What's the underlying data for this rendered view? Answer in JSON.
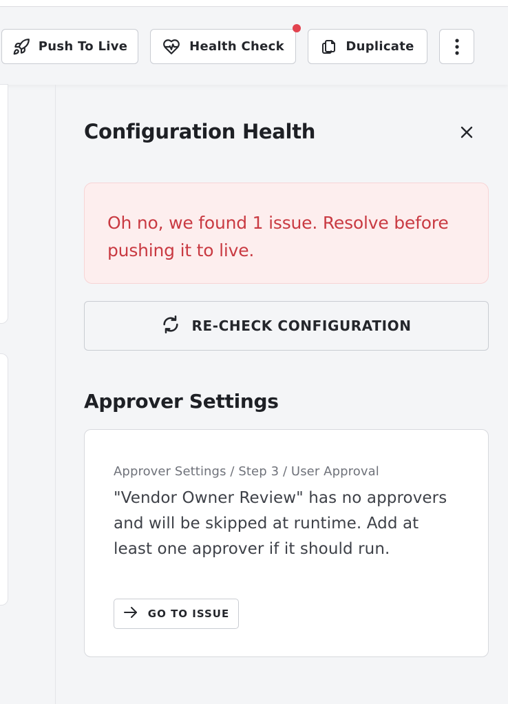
{
  "toolbar": {
    "push_label": "Push To Live",
    "push_icon": "rocket-icon",
    "health_label": "Health Check",
    "health_icon": "heart-pulse-icon",
    "health_notification": true,
    "duplicate_label": "Duplicate",
    "duplicate_icon": "copy-icon",
    "more_icon": "more-vertical-icon"
  },
  "panel": {
    "title": "Configuration Health",
    "close_icon": "close-icon",
    "alert": {
      "text": "Oh no, we found 1 issue. Resolve before pushing it to live."
    },
    "recheck": {
      "label": "RE-CHECK CONFIGURATION",
      "icon": "refresh-icon"
    },
    "section_title": "Approver Settings",
    "issues": [
      {
        "breadcrumb": "Approver Settings / Step 3 / User Approval",
        "description": "\"Vendor Owner Review\" has no approvers and will be skipped at runtime. Add at least one approver if it should run.",
        "action_label": "GO TO ISSUE",
        "action_icon": "arrow-right-icon"
      }
    ]
  },
  "colors": {
    "background": "#f4f5f7",
    "alert_background": "#fdeeee",
    "alert_text": "#c93a42",
    "notification_dot": "#e2434f",
    "border": "#c9ccd2"
  }
}
